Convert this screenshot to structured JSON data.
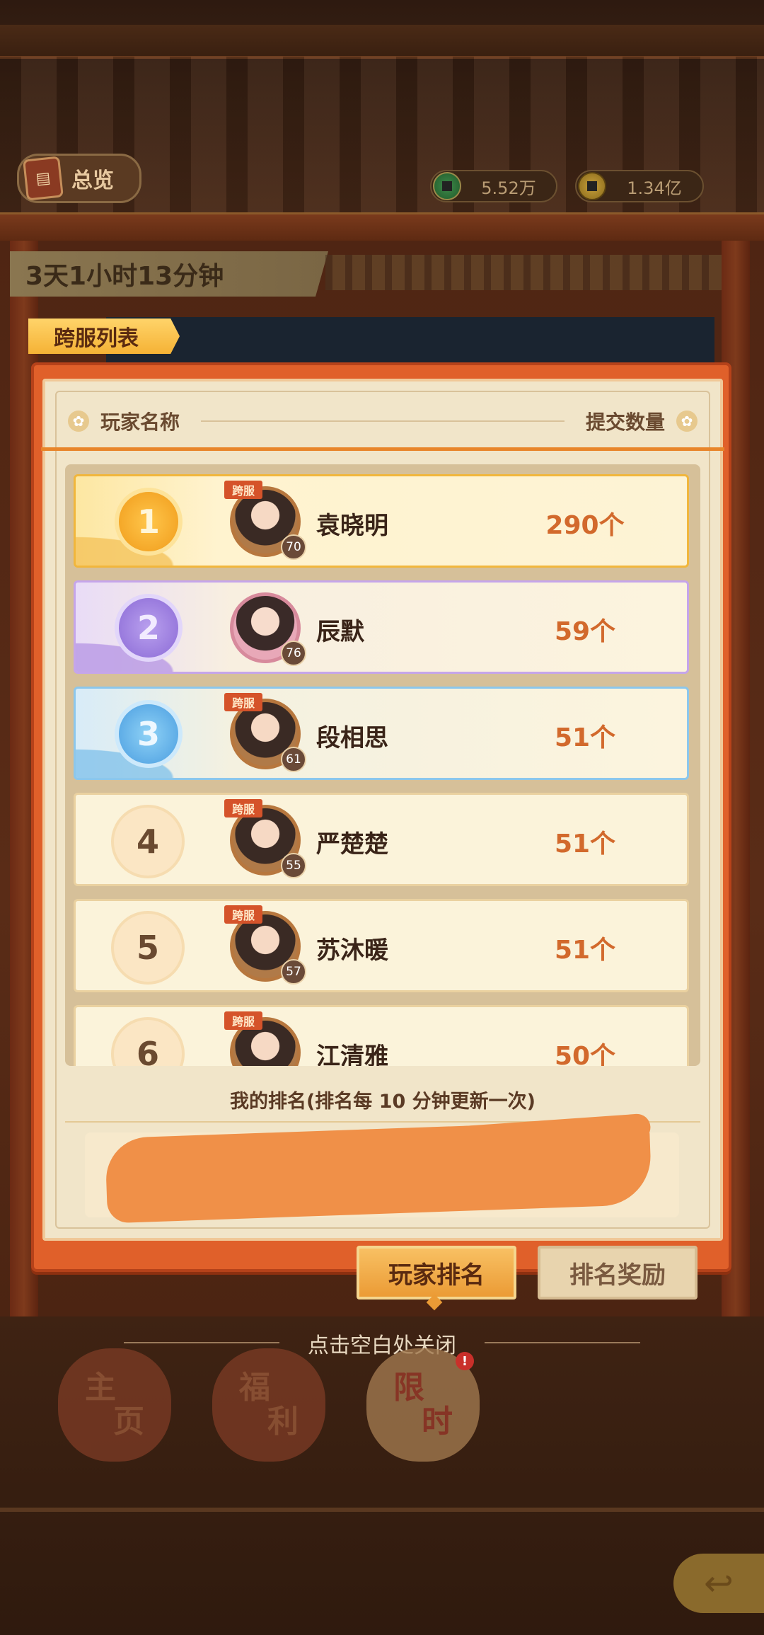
{
  "header": {
    "overview_label": "总览",
    "overview_icon": "scroll-book-icon",
    "currencies": [
      {
        "name": "jade-coin-icon",
        "value": "5.52万"
      },
      {
        "name": "gold-coin-icon",
        "value": "1.34亿"
      }
    ],
    "timer": "3天1小时13分钟"
  },
  "panel": {
    "tab_label": "跨服列表",
    "col_player": "玩家名称",
    "col_submit": "提交数量",
    "rows": [
      {
        "rank": "1",
        "name": "袁晓明",
        "count": "290个",
        "level": "70",
        "tag": "跨服",
        "style": "gold"
      },
      {
        "rank": "2",
        "name": "辰默",
        "count": "59个",
        "level": "76",
        "tag": "",
        "style": "purple"
      },
      {
        "rank": "3",
        "name": "段相思",
        "count": "51个",
        "level": "61",
        "tag": "跨服",
        "style": "blue"
      },
      {
        "rank": "4",
        "name": "严楚楚",
        "count": "51个",
        "level": "55",
        "tag": "跨服",
        "style": "plain"
      },
      {
        "rank": "5",
        "name": "苏沐暖",
        "count": "51个",
        "level": "57",
        "tag": "跨服",
        "style": "plain"
      },
      {
        "rank": "6",
        "name": "江清雅",
        "count": "50个",
        "level": "",
        "tag": "跨服",
        "style": "plain"
      }
    ],
    "my_rank_label": "我的排名(排名每 10 分钟更新一次)"
  },
  "tabs": {
    "player_rank": "玩家排名",
    "rank_reward": "排名奖励"
  },
  "close_hint": "点击空白处关闭",
  "bottom_nav": {
    "home_top": "主",
    "home_bottom": "页",
    "welfare_top": "福",
    "welfare_bottom": "利",
    "limited_top": "限",
    "limited_bottom": "时",
    "badge": "!"
  },
  "colors": {
    "panel_border": "#e0602a",
    "count_text": "#d2692c",
    "active_tab": "#eb9b35"
  }
}
